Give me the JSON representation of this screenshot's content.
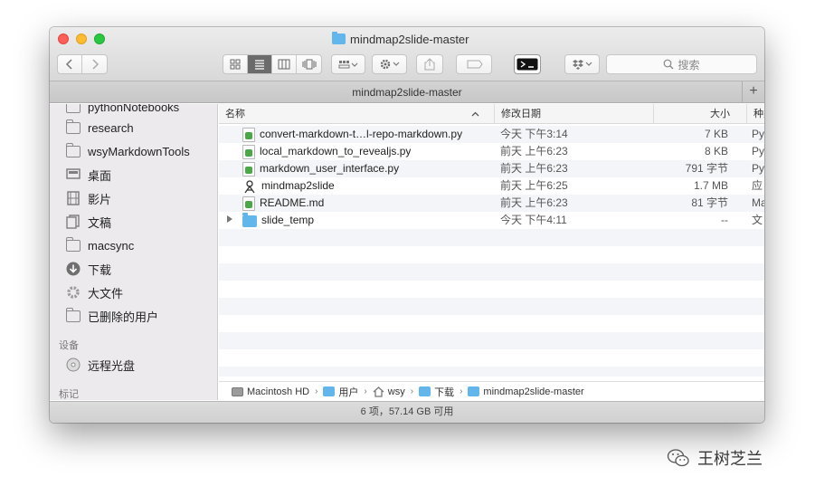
{
  "window": {
    "title": "mindmap2slide-master"
  },
  "toolbar": {
    "back_icon": "chevron-left",
    "forward_icon": "chevron-right",
    "search_placeholder": "搜索"
  },
  "tabbar": {
    "title": "mindmap2slide-master",
    "add_tab": "+"
  },
  "sidebar": {
    "items": [
      {
        "label": "pythonNotebooks",
        "icon": "folder"
      },
      {
        "label": "research",
        "icon": "folder"
      },
      {
        "label": "wsyMarkdownTools",
        "icon": "folder"
      },
      {
        "label": "桌面",
        "icon": "desktop"
      },
      {
        "label": "影片",
        "icon": "film"
      },
      {
        "label": "文稿",
        "icon": "document"
      },
      {
        "label": "macsync",
        "icon": "folder"
      },
      {
        "label": "下载",
        "icon": "download"
      },
      {
        "label": "大文件",
        "icon": "gear"
      },
      {
        "label": "已删除的用户",
        "icon": "folder"
      }
    ],
    "devices_heading": "设备",
    "devices": [
      {
        "label": "远程光盘",
        "icon": "disc"
      }
    ],
    "tags_heading": "标记"
  },
  "columns": {
    "name": "名称",
    "date": "修改日期",
    "size": "大小",
    "kind": "种类"
  },
  "files": [
    {
      "name": "convert-markdown-t…l-repo-markdown.py",
      "date": "今天 下午3:14",
      "size": "7 KB",
      "kind": "Py",
      "icon": "python-file"
    },
    {
      "name": "local_markdown_to_revealjs.py",
      "date": "前天 上午6:23",
      "size": "8 KB",
      "kind": "Py",
      "icon": "python-file"
    },
    {
      "name": "markdown_user_interface.py",
      "date": "前天 上午6:23",
      "size": "791 字节",
      "kind": "Py",
      "icon": "python-file"
    },
    {
      "name": "mindmap2slide",
      "date": "前天 上午6:25",
      "size": "1.7 MB",
      "kind": "应",
      "icon": "application"
    },
    {
      "name": "README.md",
      "date": "前天 上午6:23",
      "size": "81 字节",
      "kind": "Ma",
      "icon": "markdown-file"
    },
    {
      "name": "slide_temp",
      "date": "今天 下午4:11",
      "size": "--",
      "kind": "文",
      "icon": "folder"
    }
  ],
  "breadcrumb": [
    {
      "label": "Macintosh HD",
      "icon": "hard-drive"
    },
    {
      "label": "用户",
      "icon": "folder"
    },
    {
      "label": "wsy",
      "icon": "home"
    },
    {
      "label": "下载",
      "icon": "download-folder"
    },
    {
      "label": "mindmap2slide-master",
      "icon": "folder"
    }
  ],
  "status": {
    "text": "6 项，57.14 GB 可用"
  },
  "watermark": {
    "text": "王树芝兰"
  }
}
